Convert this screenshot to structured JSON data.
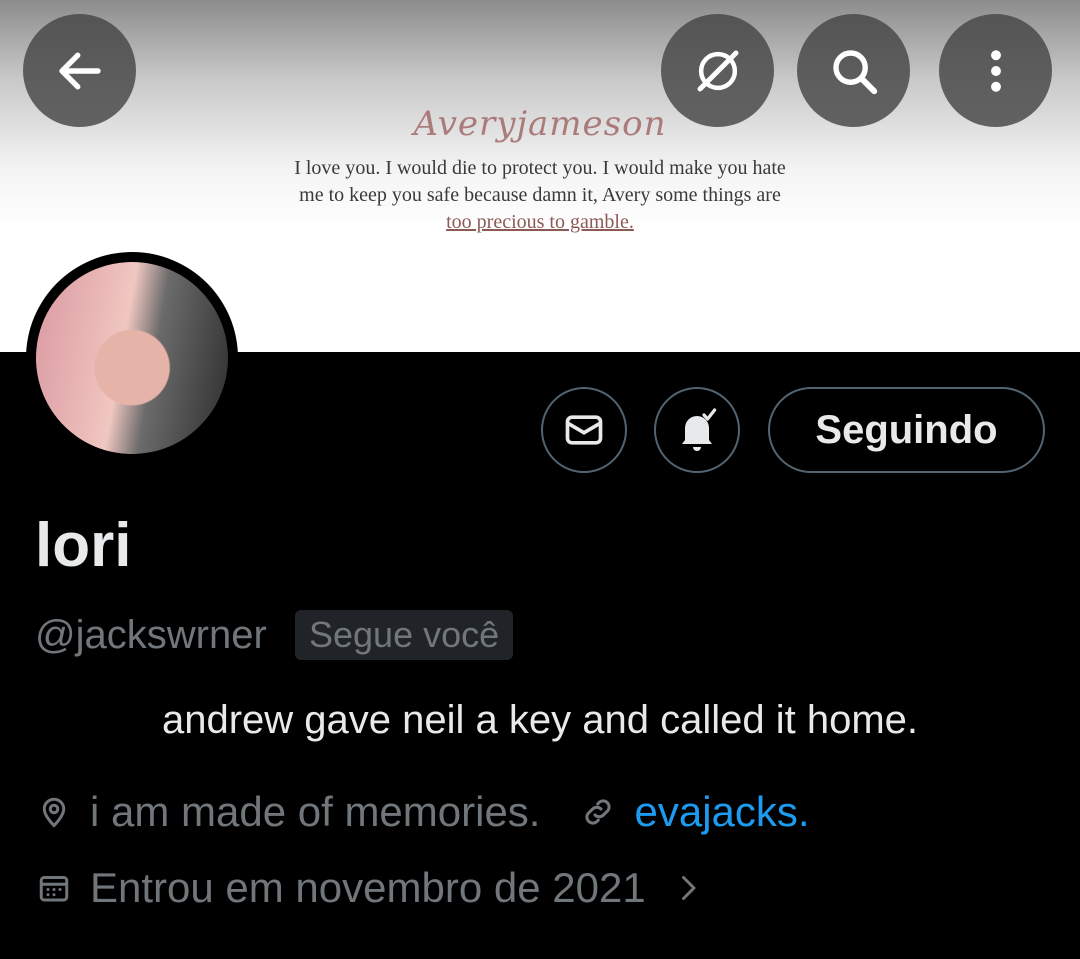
{
  "banner": {
    "signature": "Averyjameson",
    "quote_line1": "I love you. I would die to protect you. I would make you hate",
    "quote_line2": "me to keep you safe because damn it, Avery some things are",
    "quote_line3": "too precious to gamble."
  },
  "topbar": {
    "back_icon": "arrow-left-icon",
    "grok_icon": "grok-icon",
    "search_icon": "search-icon",
    "more_icon": "more-vertical-icon"
  },
  "actions": {
    "message_icon": "mail-icon",
    "notify_icon": "bell-check-icon",
    "follow_label": "Seguindo"
  },
  "profile": {
    "name": "lori",
    "handle": "@jackswrner",
    "follows_you": "Segue você",
    "bio": "andrew gave neil a key and called it home.",
    "location": "i am made of memories.",
    "website": "evajacks.",
    "joined": "Entrou em novembro de 2021"
  },
  "colors": {
    "background": "#000000",
    "text": "#e7e9ea",
    "muted": "#71767b",
    "link": "#1d9bf0",
    "border": "#536471"
  }
}
